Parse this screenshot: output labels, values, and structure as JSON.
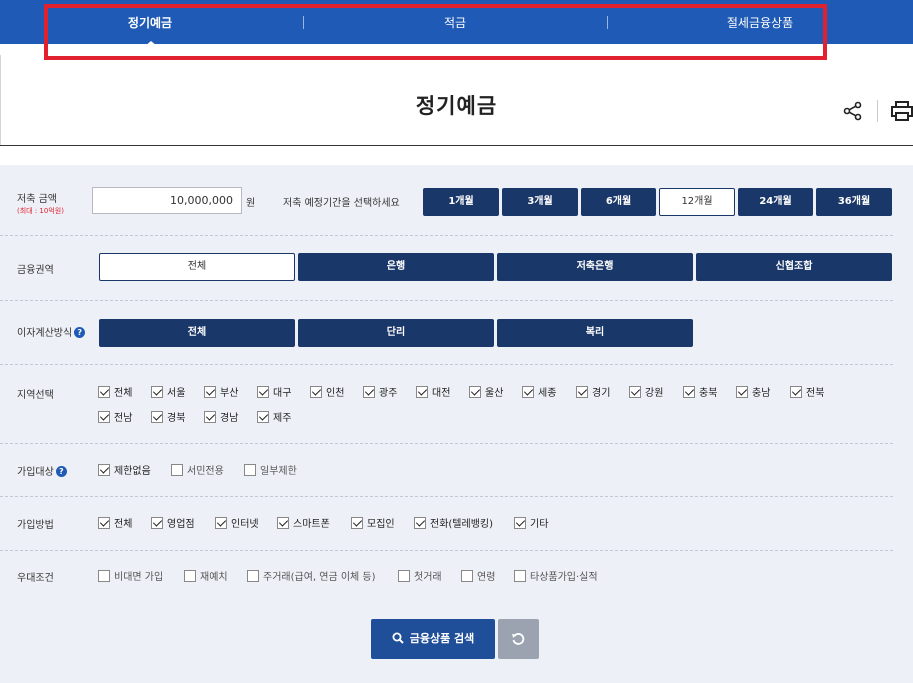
{
  "tabs": [
    {
      "label": "정기예금",
      "active": true
    },
    {
      "label": "적금",
      "active": false
    },
    {
      "label": "절세금융상품",
      "active": false
    }
  ],
  "page_title": "정기예금",
  "icons": {
    "share": "share-icon",
    "print": "print-icon",
    "search": "search-icon",
    "reset": "refresh-icon"
  },
  "colors": {
    "tab_bar": "#1f5bb6",
    "button_navy": "#1a3769",
    "highlight": "#e2212f",
    "panel_bg": "#eef0f7"
  },
  "amount": {
    "label": "저축 금액",
    "sublabel": "(최대 : 10억원)",
    "value": "10,000,000",
    "unit": "원"
  },
  "period": {
    "label": "저축 예정기간을 선택하세요",
    "options": [
      "1개월",
      "3개월",
      "6개월",
      "12개월",
      "24개월",
      "36개월"
    ],
    "selected": "12개월"
  },
  "sector": {
    "label": "금융권역",
    "options": [
      "전체",
      "은행",
      "저축은행",
      "신협조합"
    ],
    "selected": "전체"
  },
  "interest_method": {
    "label": "이자계산방식",
    "options": [
      "전체",
      "단리",
      "복리"
    ]
  },
  "region": {
    "label": "지역선택",
    "options": [
      "전체",
      "서울",
      "부산",
      "대구",
      "인천",
      "광주",
      "대전",
      "울산",
      "세종",
      "경기",
      "강원",
      "충북",
      "충남",
      "전북",
      "전남",
      "경북",
      "경남",
      "제주"
    ]
  },
  "eligibility": {
    "label": "가입대상",
    "options": [
      {
        "label": "제한없음",
        "checked": true
      },
      {
        "label": "서민전용",
        "checked": false
      },
      {
        "label": "일부제한",
        "checked": false
      }
    ]
  },
  "join_method": {
    "label": "가입방법",
    "options": [
      "전체",
      "영업점",
      "인터넷",
      "스마트폰",
      "모집인",
      "전화(텔레뱅킹)",
      "기타"
    ]
  },
  "preferential": {
    "label": "우대조건",
    "options": [
      "비대면 가입",
      "재예치",
      "주거래(급여, 연금 이체 등)",
      "첫거래",
      "연령",
      "타상품가입·실적"
    ]
  },
  "search_button": "금융상품 검색"
}
